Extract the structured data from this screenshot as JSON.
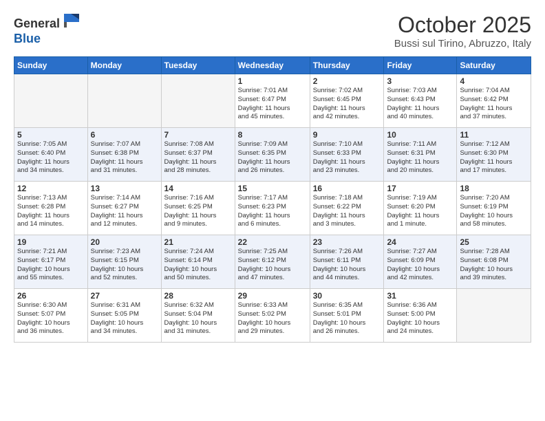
{
  "header": {
    "logo_general": "General",
    "logo_blue": "Blue",
    "month_title": "October 2025",
    "subtitle": "Bussi sul Tirino, Abruzzo, Italy"
  },
  "weekdays": [
    "Sunday",
    "Monday",
    "Tuesday",
    "Wednesday",
    "Thursday",
    "Friday",
    "Saturday"
  ],
  "weeks": [
    [
      {
        "day": "",
        "info": ""
      },
      {
        "day": "",
        "info": ""
      },
      {
        "day": "",
        "info": ""
      },
      {
        "day": "1",
        "info": "Sunrise: 7:01 AM\nSunset: 6:47 PM\nDaylight: 11 hours\nand 45 minutes."
      },
      {
        "day": "2",
        "info": "Sunrise: 7:02 AM\nSunset: 6:45 PM\nDaylight: 11 hours\nand 42 minutes."
      },
      {
        "day": "3",
        "info": "Sunrise: 7:03 AM\nSunset: 6:43 PM\nDaylight: 11 hours\nand 40 minutes."
      },
      {
        "day": "4",
        "info": "Sunrise: 7:04 AM\nSunset: 6:42 PM\nDaylight: 11 hours\nand 37 minutes."
      }
    ],
    [
      {
        "day": "5",
        "info": "Sunrise: 7:05 AM\nSunset: 6:40 PM\nDaylight: 11 hours\nand 34 minutes."
      },
      {
        "day": "6",
        "info": "Sunrise: 7:07 AM\nSunset: 6:38 PM\nDaylight: 11 hours\nand 31 minutes."
      },
      {
        "day": "7",
        "info": "Sunrise: 7:08 AM\nSunset: 6:37 PM\nDaylight: 11 hours\nand 28 minutes."
      },
      {
        "day": "8",
        "info": "Sunrise: 7:09 AM\nSunset: 6:35 PM\nDaylight: 11 hours\nand 26 minutes."
      },
      {
        "day": "9",
        "info": "Sunrise: 7:10 AM\nSunset: 6:33 PM\nDaylight: 11 hours\nand 23 minutes."
      },
      {
        "day": "10",
        "info": "Sunrise: 7:11 AM\nSunset: 6:31 PM\nDaylight: 11 hours\nand 20 minutes."
      },
      {
        "day": "11",
        "info": "Sunrise: 7:12 AM\nSunset: 6:30 PM\nDaylight: 11 hours\nand 17 minutes."
      }
    ],
    [
      {
        "day": "12",
        "info": "Sunrise: 7:13 AM\nSunset: 6:28 PM\nDaylight: 11 hours\nand 14 minutes."
      },
      {
        "day": "13",
        "info": "Sunrise: 7:14 AM\nSunset: 6:27 PM\nDaylight: 11 hours\nand 12 minutes."
      },
      {
        "day": "14",
        "info": "Sunrise: 7:16 AM\nSunset: 6:25 PM\nDaylight: 11 hours\nand 9 minutes."
      },
      {
        "day": "15",
        "info": "Sunrise: 7:17 AM\nSunset: 6:23 PM\nDaylight: 11 hours\nand 6 minutes."
      },
      {
        "day": "16",
        "info": "Sunrise: 7:18 AM\nSunset: 6:22 PM\nDaylight: 11 hours\nand 3 minutes."
      },
      {
        "day": "17",
        "info": "Sunrise: 7:19 AM\nSunset: 6:20 PM\nDaylight: 11 hours\nand 1 minute."
      },
      {
        "day": "18",
        "info": "Sunrise: 7:20 AM\nSunset: 6:19 PM\nDaylight: 10 hours\nand 58 minutes."
      }
    ],
    [
      {
        "day": "19",
        "info": "Sunrise: 7:21 AM\nSunset: 6:17 PM\nDaylight: 10 hours\nand 55 minutes."
      },
      {
        "day": "20",
        "info": "Sunrise: 7:23 AM\nSunset: 6:15 PM\nDaylight: 10 hours\nand 52 minutes."
      },
      {
        "day": "21",
        "info": "Sunrise: 7:24 AM\nSunset: 6:14 PM\nDaylight: 10 hours\nand 50 minutes."
      },
      {
        "day": "22",
        "info": "Sunrise: 7:25 AM\nSunset: 6:12 PM\nDaylight: 10 hours\nand 47 minutes."
      },
      {
        "day": "23",
        "info": "Sunrise: 7:26 AM\nSunset: 6:11 PM\nDaylight: 10 hours\nand 44 minutes."
      },
      {
        "day": "24",
        "info": "Sunrise: 7:27 AM\nSunset: 6:09 PM\nDaylight: 10 hours\nand 42 minutes."
      },
      {
        "day": "25",
        "info": "Sunrise: 7:28 AM\nSunset: 6:08 PM\nDaylight: 10 hours\nand 39 minutes."
      }
    ],
    [
      {
        "day": "26",
        "info": "Sunrise: 6:30 AM\nSunset: 5:07 PM\nDaylight: 10 hours\nand 36 minutes."
      },
      {
        "day": "27",
        "info": "Sunrise: 6:31 AM\nSunset: 5:05 PM\nDaylight: 10 hours\nand 34 minutes."
      },
      {
        "day": "28",
        "info": "Sunrise: 6:32 AM\nSunset: 5:04 PM\nDaylight: 10 hours\nand 31 minutes."
      },
      {
        "day": "29",
        "info": "Sunrise: 6:33 AM\nSunset: 5:02 PM\nDaylight: 10 hours\nand 29 minutes."
      },
      {
        "day": "30",
        "info": "Sunrise: 6:35 AM\nSunset: 5:01 PM\nDaylight: 10 hours\nand 26 minutes."
      },
      {
        "day": "31",
        "info": "Sunrise: 6:36 AM\nSunset: 5:00 PM\nDaylight: 10 hours\nand 24 minutes."
      },
      {
        "day": "",
        "info": ""
      }
    ]
  ]
}
